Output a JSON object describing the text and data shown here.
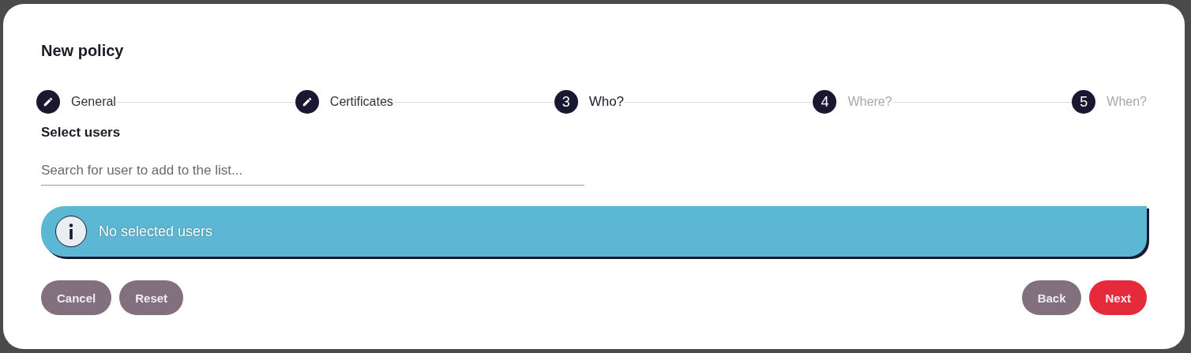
{
  "dialog": {
    "title": "New policy"
  },
  "steps": [
    {
      "label": "General",
      "completed": true,
      "current": false
    },
    {
      "label": "Certificates",
      "completed": true,
      "current": false
    },
    {
      "label": "Who?",
      "number": "3",
      "completed": false,
      "current": true
    },
    {
      "label": "Where?",
      "number": "4",
      "completed": false,
      "current": false
    },
    {
      "label": "When?",
      "number": "5",
      "completed": false,
      "current": false
    }
  ],
  "section": {
    "title": "Select users"
  },
  "search": {
    "placeholder": "Search for user to add to the list..."
  },
  "notice": {
    "text": "No selected users"
  },
  "buttons_left": [
    {
      "label": "Cancel",
      "primary": false
    },
    {
      "label": "Reset",
      "primary": false
    }
  ],
  "buttons_right": [
    {
      "label": "Back",
      "primary": false
    },
    {
      "label": "Next",
      "primary": true
    }
  ]
}
